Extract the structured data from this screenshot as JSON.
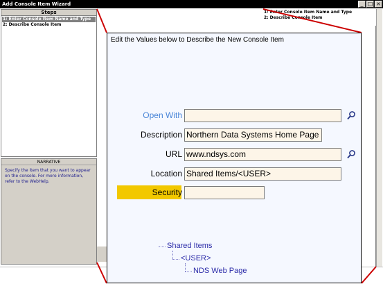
{
  "window": {
    "title": "Add Console Item Wizard",
    "controls": [
      "_",
      "□",
      "×"
    ]
  },
  "steps": {
    "header": "Steps",
    "items": [
      {
        "label": "1: Enter Console Item Name and Type",
        "selected": true
      },
      {
        "label": "2: Describe Console Item",
        "selected": false
      }
    ]
  },
  "narrative": {
    "header": "NARRATIVE",
    "text": "Specify the item that you want to appear on the console. For more information, refer to the WebHelp."
  },
  "right_steps": {
    "items": [
      "1: Enter Console Item Name and Type",
      "2: Describe Console Item"
    ]
  },
  "form": {
    "heading": "Edit the Values below to Describe the New Console Item",
    "fields": {
      "open_with": {
        "label": "Open With",
        "value": ""
      },
      "description": {
        "label": "Description",
        "value": "Northern Data Systems Home Page"
      },
      "url": {
        "label": "URL",
        "value": "www.ndsys.com"
      },
      "location": {
        "label": "Location",
        "value": "Shared Items/<USER>"
      },
      "security": {
        "label": "Security",
        "value": ""
      }
    }
  },
  "tree": {
    "root": "Shared Items",
    "child": "<USER>",
    "leaf": "NDS Web Page"
  },
  "icons": {
    "open_with_lookup": "magnifier-icon",
    "url_lookup": "magnifier-icon"
  },
  "colors": {
    "highlight": "#f2c800",
    "callout": "#cc0000",
    "link": "#4a86d8",
    "tree_text": "#2a2aa8"
  }
}
